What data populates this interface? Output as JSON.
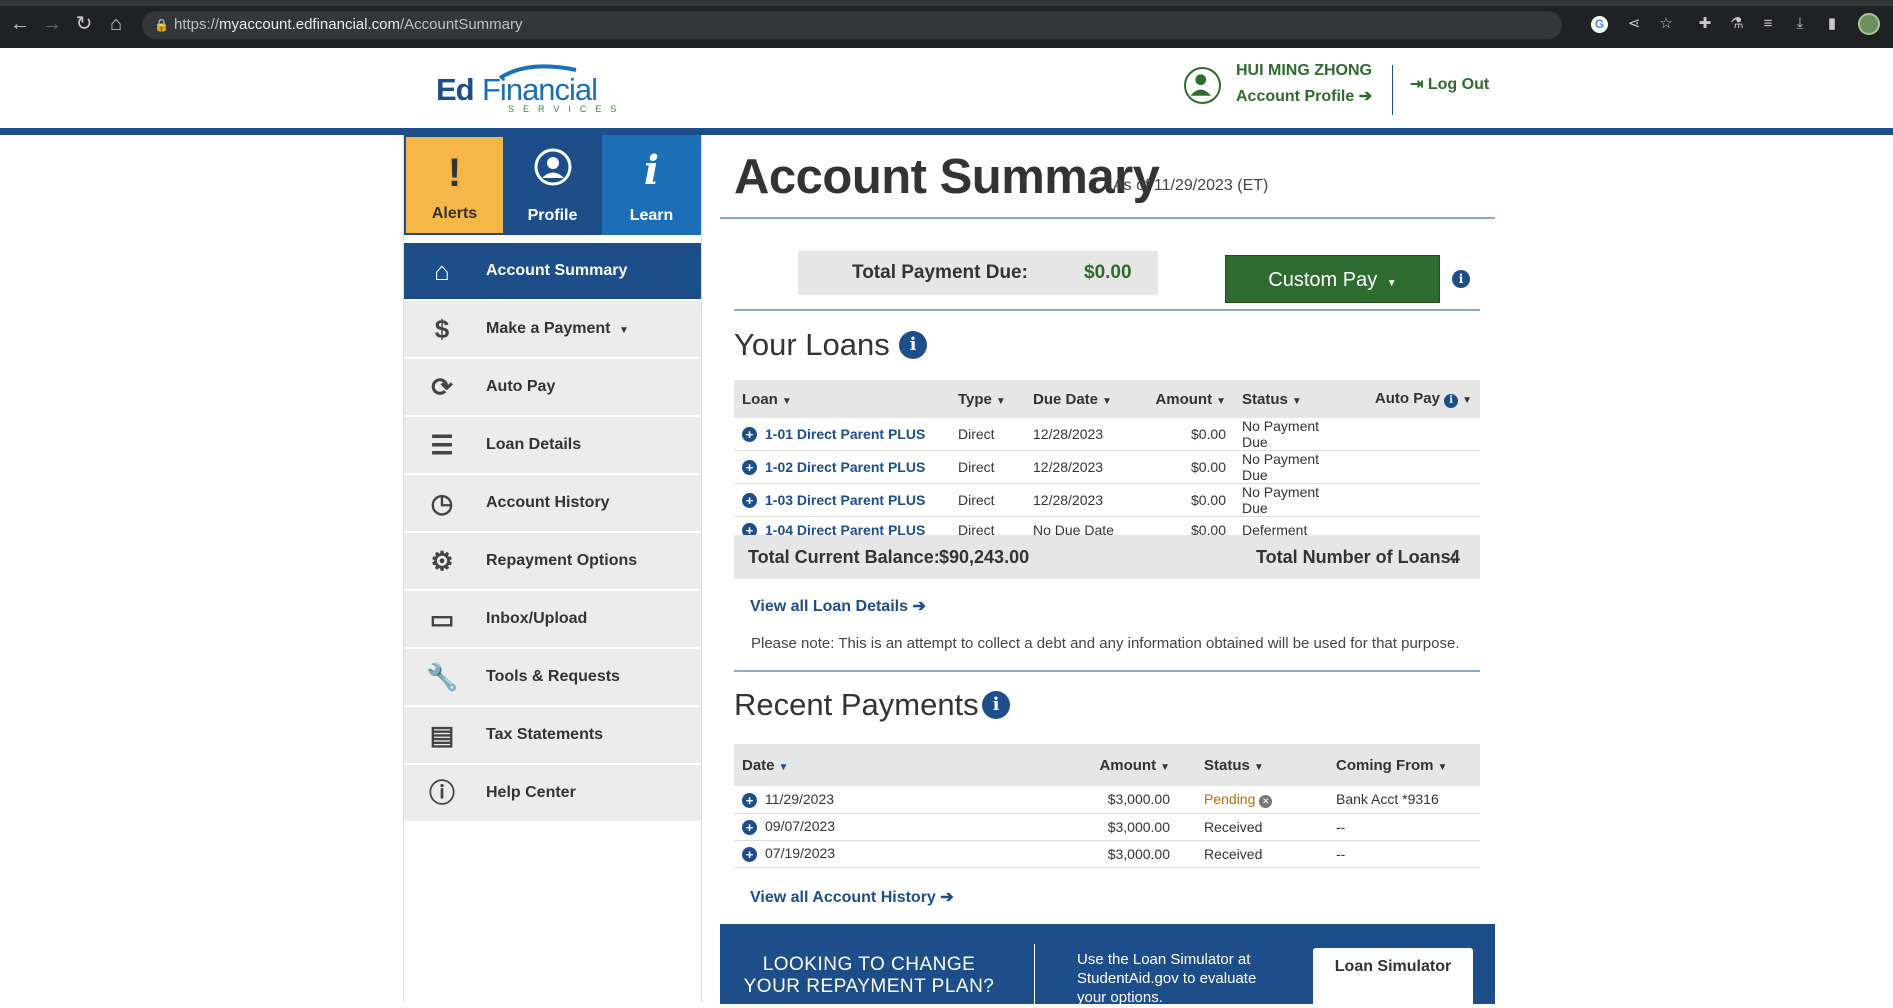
{
  "browser": {
    "url_prefix": "https://",
    "url_host": "myaccount.edfinancial.com",
    "url_path": "/AccountSummary"
  },
  "header": {
    "logo_ed": "Ed",
    "logo_financial": "Financial",
    "logo_services": "SERVICES",
    "user_name": "HUI MING ZHONG",
    "account_profile": "Account Profile",
    "logout": "Log Out"
  },
  "sidebar": {
    "tiles": [
      {
        "label": "Alerts",
        "icon": "exclamation-icon"
      },
      {
        "label": "Profile",
        "icon": "user-circle-icon"
      },
      {
        "label": "Learn",
        "icon": "info-icon"
      }
    ],
    "items": [
      {
        "label": "Account Summary",
        "icon": "home-icon"
      },
      {
        "label": "Make a Payment",
        "icon": "dollar-icon"
      },
      {
        "label": "Auto Pay",
        "icon": "auto-pay-icon"
      },
      {
        "label": "Loan Details",
        "icon": "list-icon"
      },
      {
        "label": "Account History",
        "icon": "clock-icon"
      },
      {
        "label": "Repayment Options",
        "icon": "gear-icon"
      },
      {
        "label": "Inbox/Upload",
        "icon": "inbox-icon"
      },
      {
        "label": "Tools & Requests",
        "icon": "wrench-icon"
      },
      {
        "label": "Tax Statements",
        "icon": "document-icon"
      },
      {
        "label": "Help Center",
        "icon": "question-icon"
      }
    ]
  },
  "main": {
    "title": "Account Summary",
    "as_of": "As of 11/29/2023 (ET)",
    "total_payment_due_label": "Total Payment Due:",
    "total_payment_due_value": "$0.00",
    "custom_pay": "Custom Pay",
    "your_loans_title": "Your Loans",
    "loans_headers": {
      "loan": "Loan",
      "type": "Type",
      "due_date": "Due Date",
      "amount": "Amount",
      "status": "Status",
      "auto_pay": "Auto Pay"
    },
    "loans": [
      {
        "loan": "1-01 Direct Parent PLUS",
        "type": "Direct",
        "due_date": "12/28/2023",
        "amount": "$0.00",
        "status": "No Payment Due"
      },
      {
        "loan": "1-02 Direct Parent PLUS",
        "type": "Direct",
        "due_date": "12/28/2023",
        "amount": "$0.00",
        "status": "No Payment Due"
      },
      {
        "loan": "1-03 Direct Parent PLUS",
        "type": "Direct",
        "due_date": "12/28/2023",
        "amount": "$0.00",
        "status": "No Payment Due"
      },
      {
        "loan": "1-04 Direct Parent PLUS",
        "type": "Direct",
        "due_date": "No Due Date",
        "amount": "$0.00",
        "status": "Deferment"
      }
    ],
    "total_balance_label": "Total Current Balance:",
    "total_balance_value": "$90,243.00",
    "total_loans_label": "Total Number of Loans:",
    "total_loans_value": "4",
    "view_all_loan_details": "View all Loan Details",
    "note": "Please note: This is an attempt to collect a debt and any information obtained will be used for that purpose.",
    "recent_payments_title": "Recent Payments",
    "payments_headers": {
      "date": "Date",
      "amount": "Amount",
      "status": "Status",
      "coming_from": "Coming From"
    },
    "payments": [
      {
        "date": "11/29/2023",
        "amount": "$3,000.00",
        "status": "Pending",
        "from": "Bank Acct *9316"
      },
      {
        "date": "09/07/2023",
        "amount": "$3,000.00",
        "status": "Received",
        "from": "--"
      },
      {
        "date": "07/19/2023",
        "amount": "$3,000.00",
        "status": "Received",
        "from": "--"
      }
    ],
    "view_all_account_history": "View all Account History",
    "banner_left": "LOOKING TO CHANGE YOUR REPAYMENT PLAN?",
    "banner_mid": "Use the Loan Simulator at StudentAid.gov to evaluate your options.",
    "banner_button": "Loan Simulator"
  },
  "colors": {
    "brand_blue": "#1d4e89",
    "brand_green": "#2e6b2e",
    "alert_yellow": "#f6b648"
  }
}
